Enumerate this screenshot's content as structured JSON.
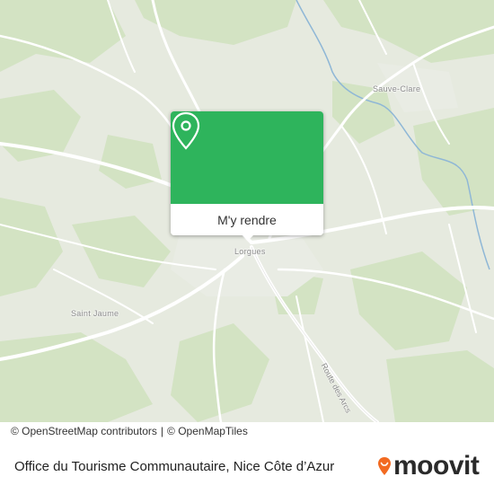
{
  "map": {
    "places": {
      "lorgues": "Lorgues",
      "sauve_clare": "Sauve-Clare",
      "saint_jaume": "Saint Jaume"
    },
    "road_label": "Route des Arcs",
    "pin_icon": "location-pin-icon"
  },
  "popup": {
    "button_label": "M'y rendre",
    "color": "#2eb45c"
  },
  "attribution": {
    "osm": "© OpenStreetMap contributors",
    "separator": "|",
    "tiles": "© OpenMapTiles"
  },
  "footer": {
    "title": "Office du Tourisme Communautaire, Nice Côte d’Azur",
    "brand": "moovit",
    "brand_color": "#f26a21"
  }
}
